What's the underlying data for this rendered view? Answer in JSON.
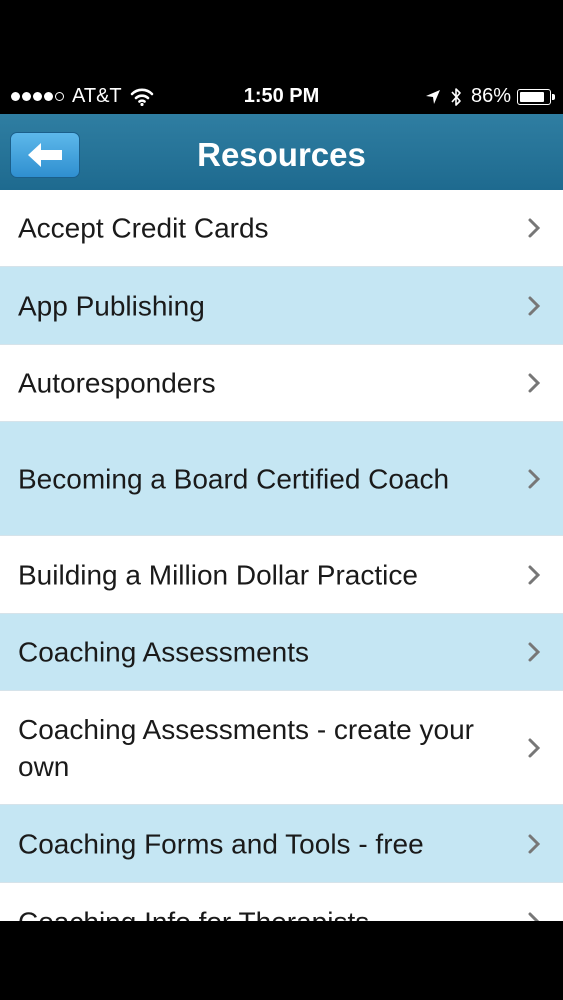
{
  "status_bar": {
    "carrier": "AT&T",
    "time": "1:50 PM",
    "battery": "86%",
    "battery_level": 0.86,
    "signal_bars_filled": 4,
    "signal_bars_total": 5
  },
  "nav": {
    "title": "Resources",
    "back_icon": "back-arrow-icon"
  },
  "colors": {
    "nav_bar": "#2676a0",
    "back_button": "#45a6e0",
    "row_alt": "#c5e6f3",
    "row": "#ffffff"
  },
  "resources": [
    {
      "label": "Accept Credit Cards"
    },
    {
      "label": "App Publishing"
    },
    {
      "label": "Autoresponders"
    },
    {
      "label": "Becoming a Board Certified Coach"
    },
    {
      "label": "Building a Million Dollar Practice"
    },
    {
      "label": "Coaching Assessments"
    },
    {
      "label": "Coaching Assessments - create your own"
    },
    {
      "label": "Coaching Forms and Tools - free"
    },
    {
      "label": "Coaching Info for Therapists"
    }
  ]
}
